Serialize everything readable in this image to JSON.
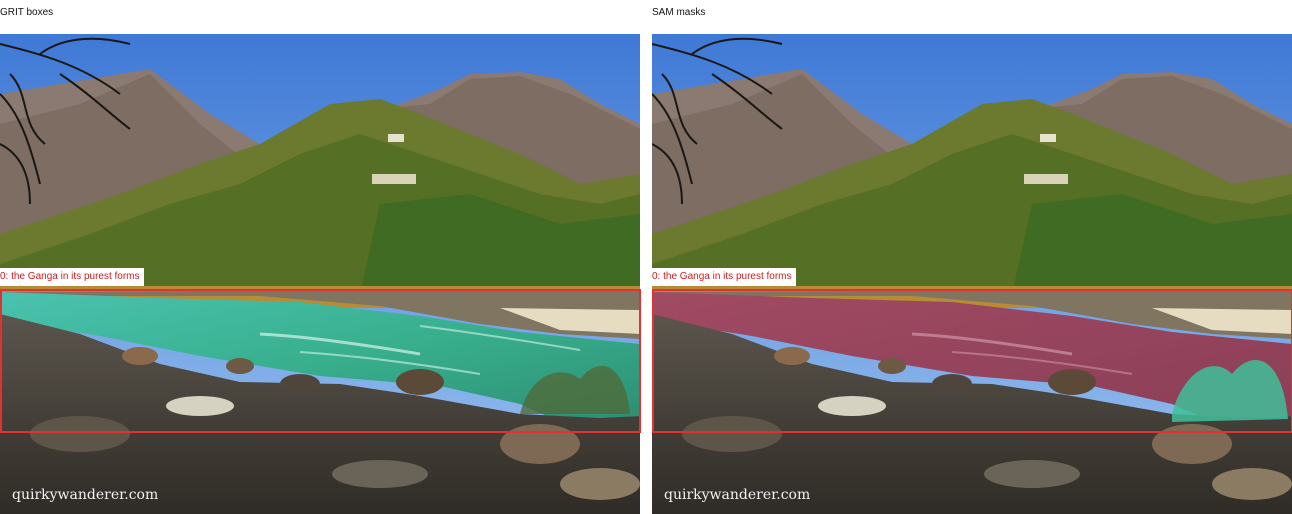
{
  "panels": [
    {
      "title": "GRIT boxes",
      "box_label": "0: the Ganga in its purest forms",
      "mask": "none"
    },
    {
      "title": "SAM masks",
      "box_label": "0: the Ganga in its purest forms",
      "mask": "segmentation"
    }
  ],
  "watermark": "quirkywanderer.com",
  "colors": {
    "box_border": "#e03232",
    "label_text": "#cc1f1f",
    "mask_river": "#b4486a",
    "mask_shrub": "#3fbf9a"
  }
}
